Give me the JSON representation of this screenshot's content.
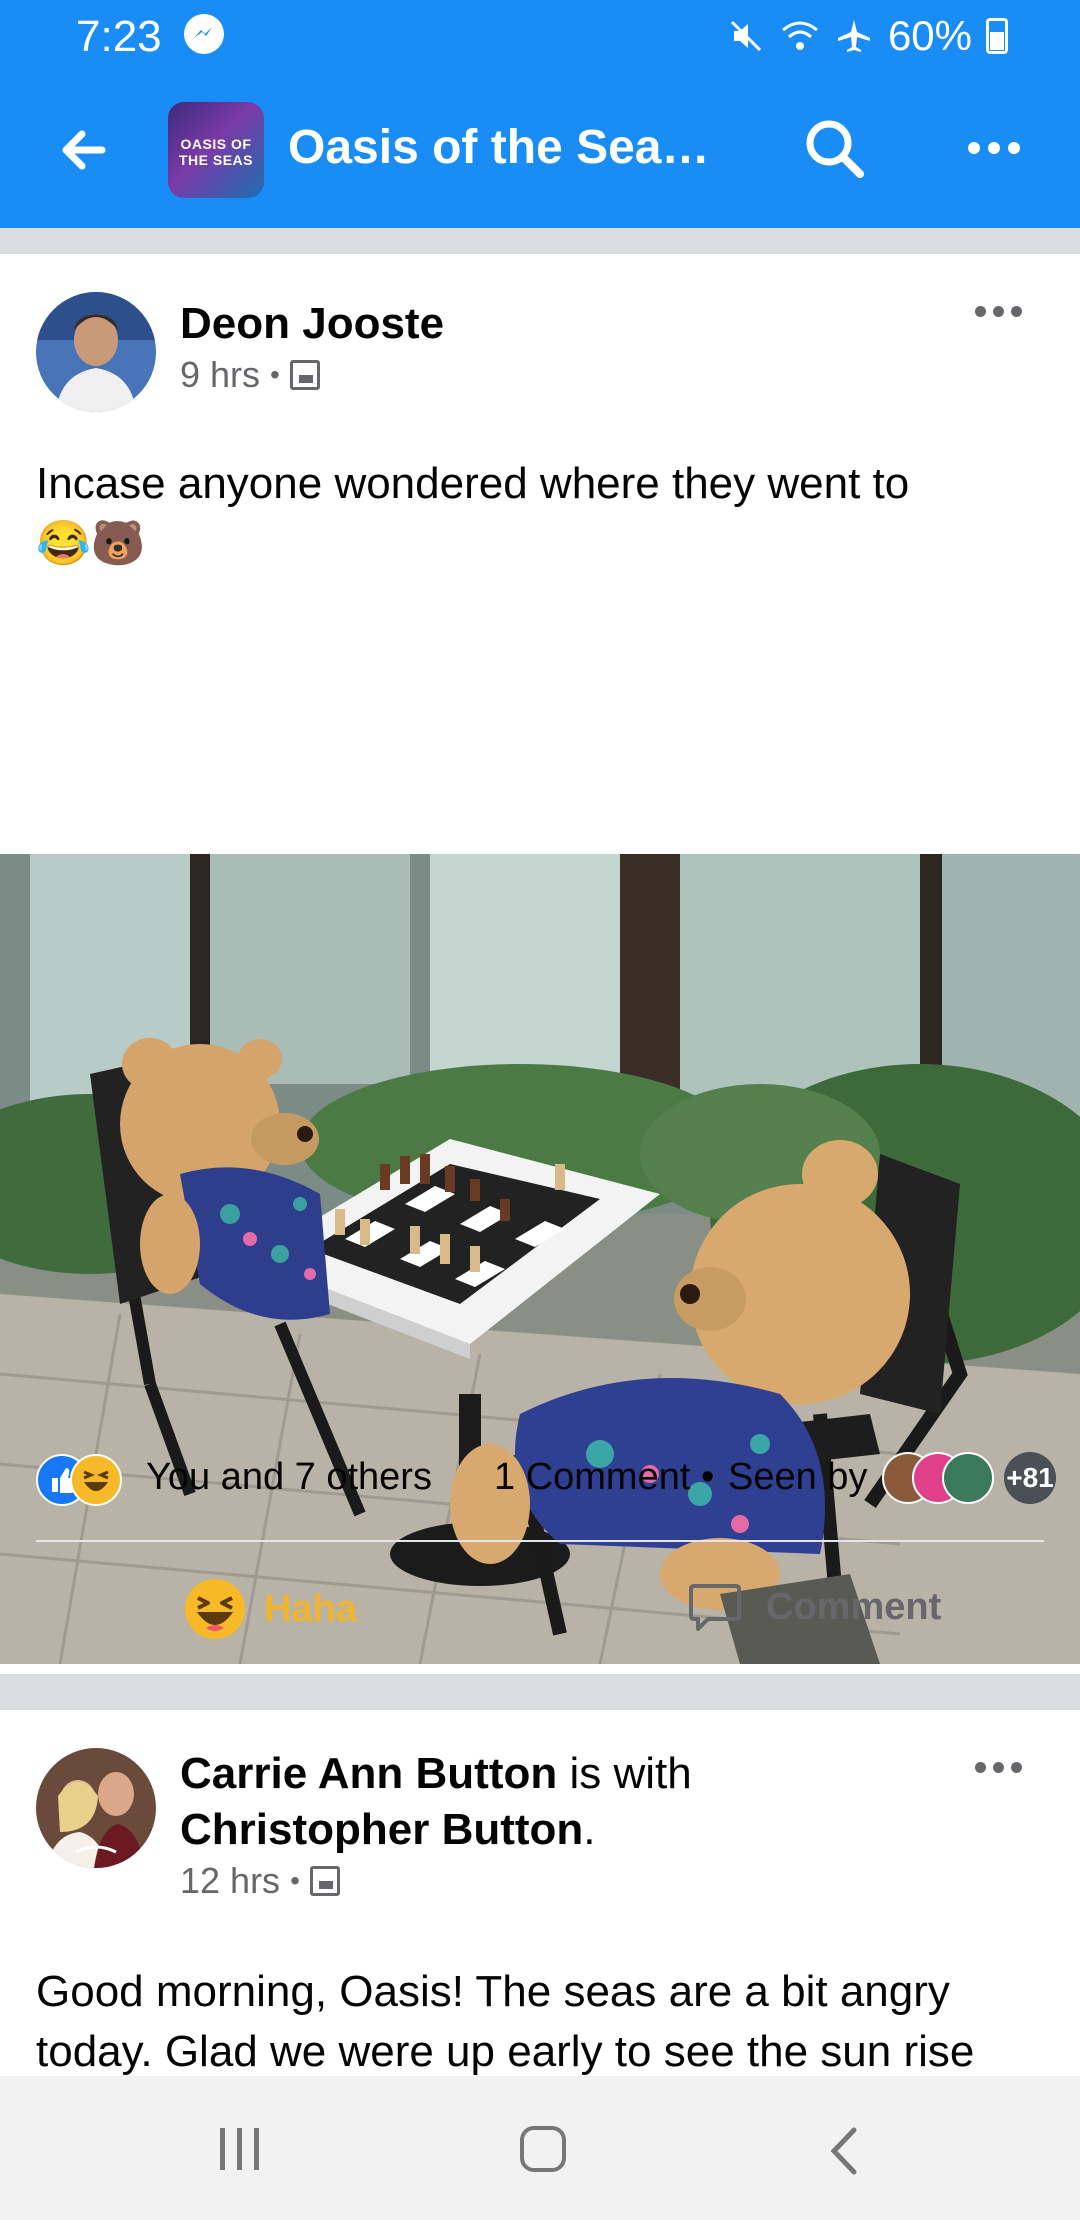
{
  "status_bar": {
    "time": "7:23",
    "battery": "60%"
  },
  "header": {
    "group_thumb_text": "OASIS OF THE SEAS",
    "title": "Oasis of the Seas…"
  },
  "posts": [
    {
      "author": "Deon Jooste",
      "time": "9 hrs",
      "text": "Incase anyone wondered where they went to",
      "text_emojis": "😂🐻",
      "reactions_text": "You and 7 others",
      "comment_count": "1 Comment",
      "seen_by_label": "Seen by",
      "seen_more": "+81",
      "action_reaction": "Haha",
      "action_comment": "Comment"
    },
    {
      "author": "Carrie Ann Button",
      "with_text": "is with",
      "with_name": "Christopher Button",
      "with_end": ".",
      "time": "12 hrs",
      "text": "Good morning, Oasis!  The seas are a bit angry today. Glad we were up early to see the sun rise"
    }
  ],
  "colors": {
    "header": "#1a8cf5",
    "like": "#1877f2",
    "haha": "#f7b928",
    "muted": "#65676b"
  }
}
